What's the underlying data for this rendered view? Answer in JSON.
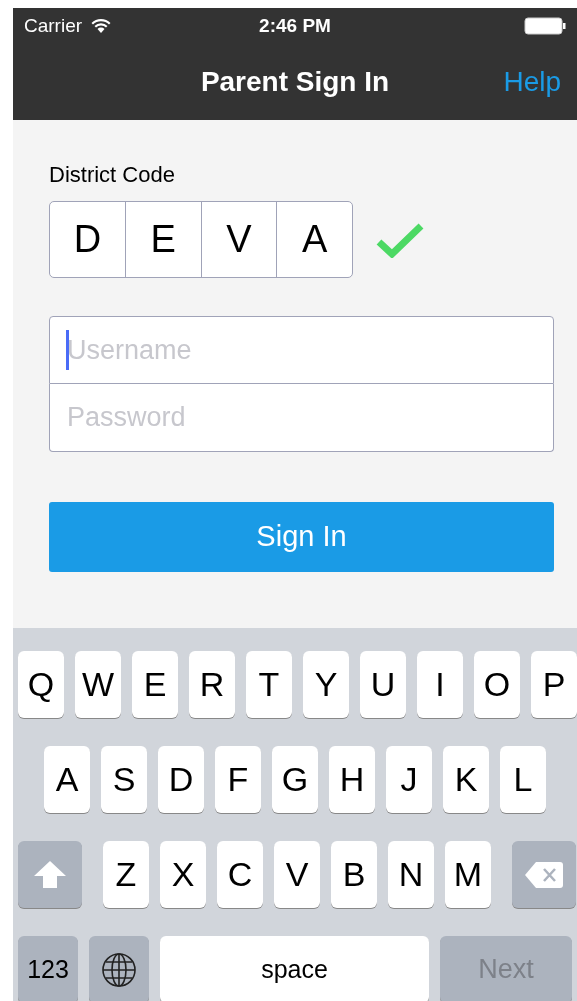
{
  "status_bar": {
    "carrier": "Carrier",
    "time": "2:46 PM"
  },
  "nav_bar": {
    "title": "Parent Sign In",
    "action": "Help"
  },
  "district_code": {
    "label": "District Code",
    "letters": [
      "D",
      "E",
      "V",
      "A"
    ],
    "valid": true
  },
  "fields": [
    {
      "placeholder": "Username",
      "focused": true
    },
    {
      "placeholder": "Password",
      "focused": false
    }
  ],
  "sign_in_button": "Sign In",
  "keyboard": {
    "rows": [
      {
        "keys": [
          {
            "kind": "letter",
            "label": "Q"
          },
          {
            "kind": "letter",
            "label": "W"
          },
          {
            "kind": "letter",
            "label": "E"
          },
          {
            "kind": "letter",
            "label": "R"
          },
          {
            "kind": "letter",
            "label": "T"
          },
          {
            "kind": "letter",
            "label": "Y"
          },
          {
            "kind": "letter",
            "label": "U"
          },
          {
            "kind": "letter",
            "label": "I"
          },
          {
            "kind": "letter",
            "label": "O"
          },
          {
            "kind": "letter",
            "label": "P"
          }
        ]
      },
      {
        "keys": [
          {
            "kind": "letter",
            "label": "A"
          },
          {
            "kind": "letter",
            "label": "S"
          },
          {
            "kind": "letter",
            "label": "D"
          },
          {
            "kind": "letter",
            "label": "F"
          },
          {
            "kind": "letter",
            "label": "G"
          },
          {
            "kind": "letter",
            "label": "H"
          },
          {
            "kind": "letter",
            "label": "J"
          },
          {
            "kind": "letter",
            "label": "K"
          },
          {
            "kind": "letter",
            "label": "L"
          }
        ]
      },
      {
        "keys": [
          {
            "kind": "shift"
          },
          {
            "kind": "letter",
            "label": "Z"
          },
          {
            "kind": "letter",
            "label": "X"
          },
          {
            "kind": "letter",
            "label": "C"
          },
          {
            "kind": "letter",
            "label": "V"
          },
          {
            "kind": "letter",
            "label": "B"
          },
          {
            "kind": "letter",
            "label": "N"
          },
          {
            "kind": "letter",
            "label": "M"
          },
          {
            "kind": "delete"
          }
        ]
      },
      {
        "keys": [
          {
            "kind": "numbers",
            "label": "123"
          },
          {
            "kind": "globe"
          },
          {
            "kind": "space",
            "label": "space"
          },
          {
            "kind": "return",
            "label": "Next"
          }
        ]
      }
    ]
  }
}
